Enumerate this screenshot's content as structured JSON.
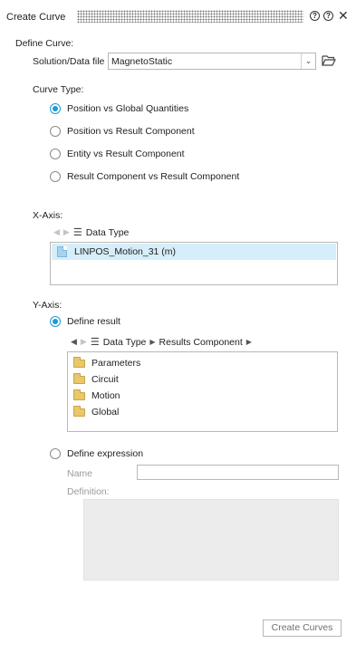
{
  "window": {
    "title": "Create Curve",
    "header_icons": [
      "help-icon",
      "settings-icon",
      "close-icon"
    ]
  },
  "define_curve": {
    "label": "Define Curve:",
    "solution_label": "Solution/Data file",
    "solution_value": "MagnetoStatic"
  },
  "curve_type": {
    "label": "Curve Type:",
    "options": [
      {
        "label": "Position vs Global Quantities",
        "selected": true
      },
      {
        "label": "Position vs Result Component",
        "selected": false
      },
      {
        "label": "Entity vs Result Component",
        "selected": false
      },
      {
        "label": "Result Component vs Result Component",
        "selected": false
      }
    ]
  },
  "x_axis": {
    "label": "X-Axis:",
    "breadcrumb": "Data Type",
    "items": [
      "LINPOS_Motion_31 (m)"
    ]
  },
  "y_axis": {
    "label": "Y-Axis:",
    "define_result_label": "Define result",
    "define_result_selected": true,
    "breadcrumb": [
      "Data Type",
      "Results Component"
    ],
    "items": [
      "Parameters",
      "Circuit",
      "Motion",
      "Global"
    ],
    "define_expression_label": "Define expression",
    "name_label": "Name",
    "name_value": "",
    "definition_label": "Definition:"
  },
  "footer": {
    "create_button": "Create Curves"
  }
}
